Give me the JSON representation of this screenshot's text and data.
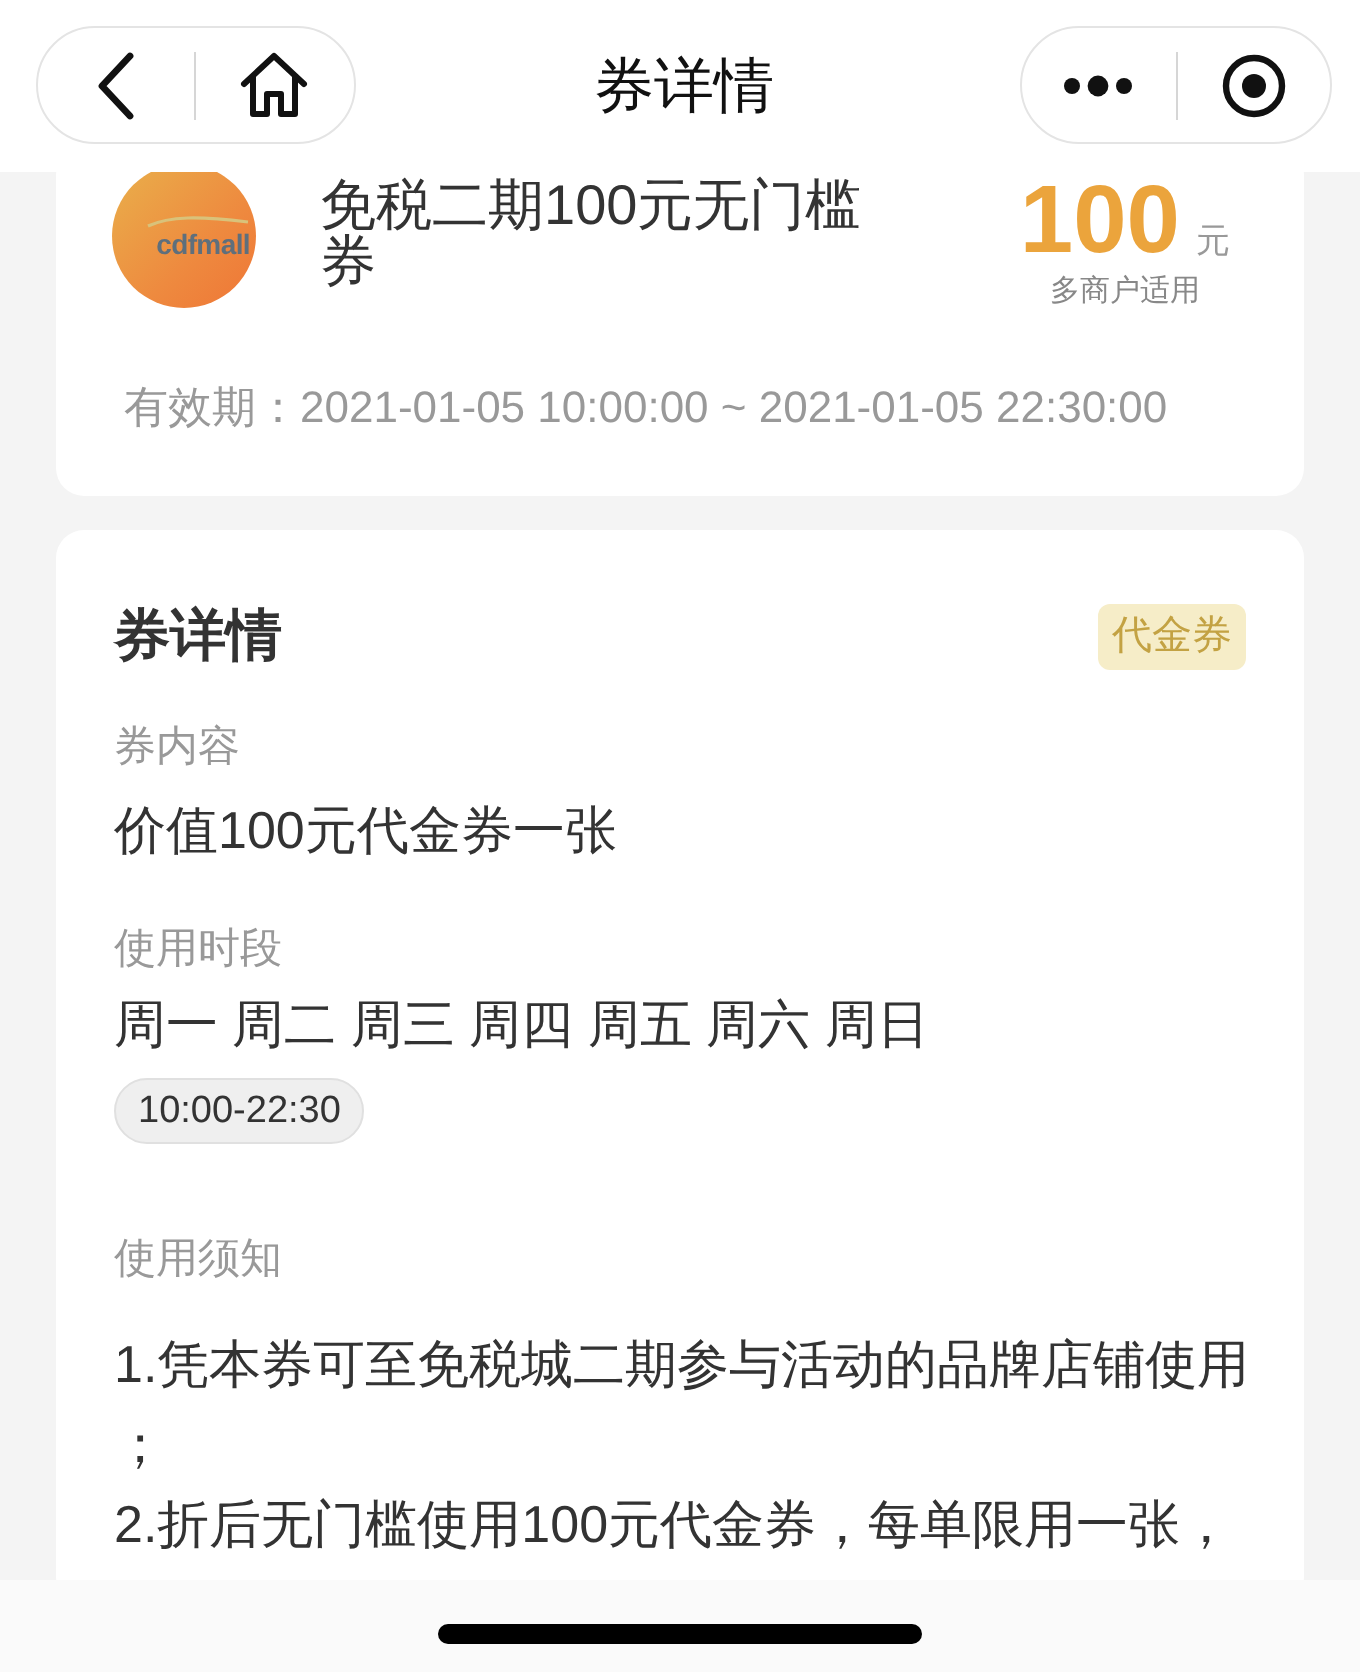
{
  "nav": {
    "title": "券详情"
  },
  "coupon": {
    "logo_text": "cdfmall",
    "name": "免税二期100元无门槛券",
    "amount": "100",
    "unit": "元",
    "scope": "多商户适用",
    "validity": "有效期：2021-01-05 10:00:00 ~ 2021-01-05 22:30:00"
  },
  "details": {
    "title": "券详情",
    "tag": "代金券",
    "sections": [
      {
        "kind": "text",
        "label": "券内容",
        "value": "价值100元代金券一张"
      },
      {
        "kind": "schedule",
        "label": "使用时段",
        "value": "周一 周二 周三 周四 周五 周六 周日",
        "time": "10:00-22:30"
      },
      {
        "kind": "notes",
        "label": "使用须知",
        "items": [
          "1.凭本券可至免税城二期参与活动的品牌店铺使用；",
          "2.折后无门槛使用100元代金券，每单限用一张，"
        ]
      }
    ]
  }
}
